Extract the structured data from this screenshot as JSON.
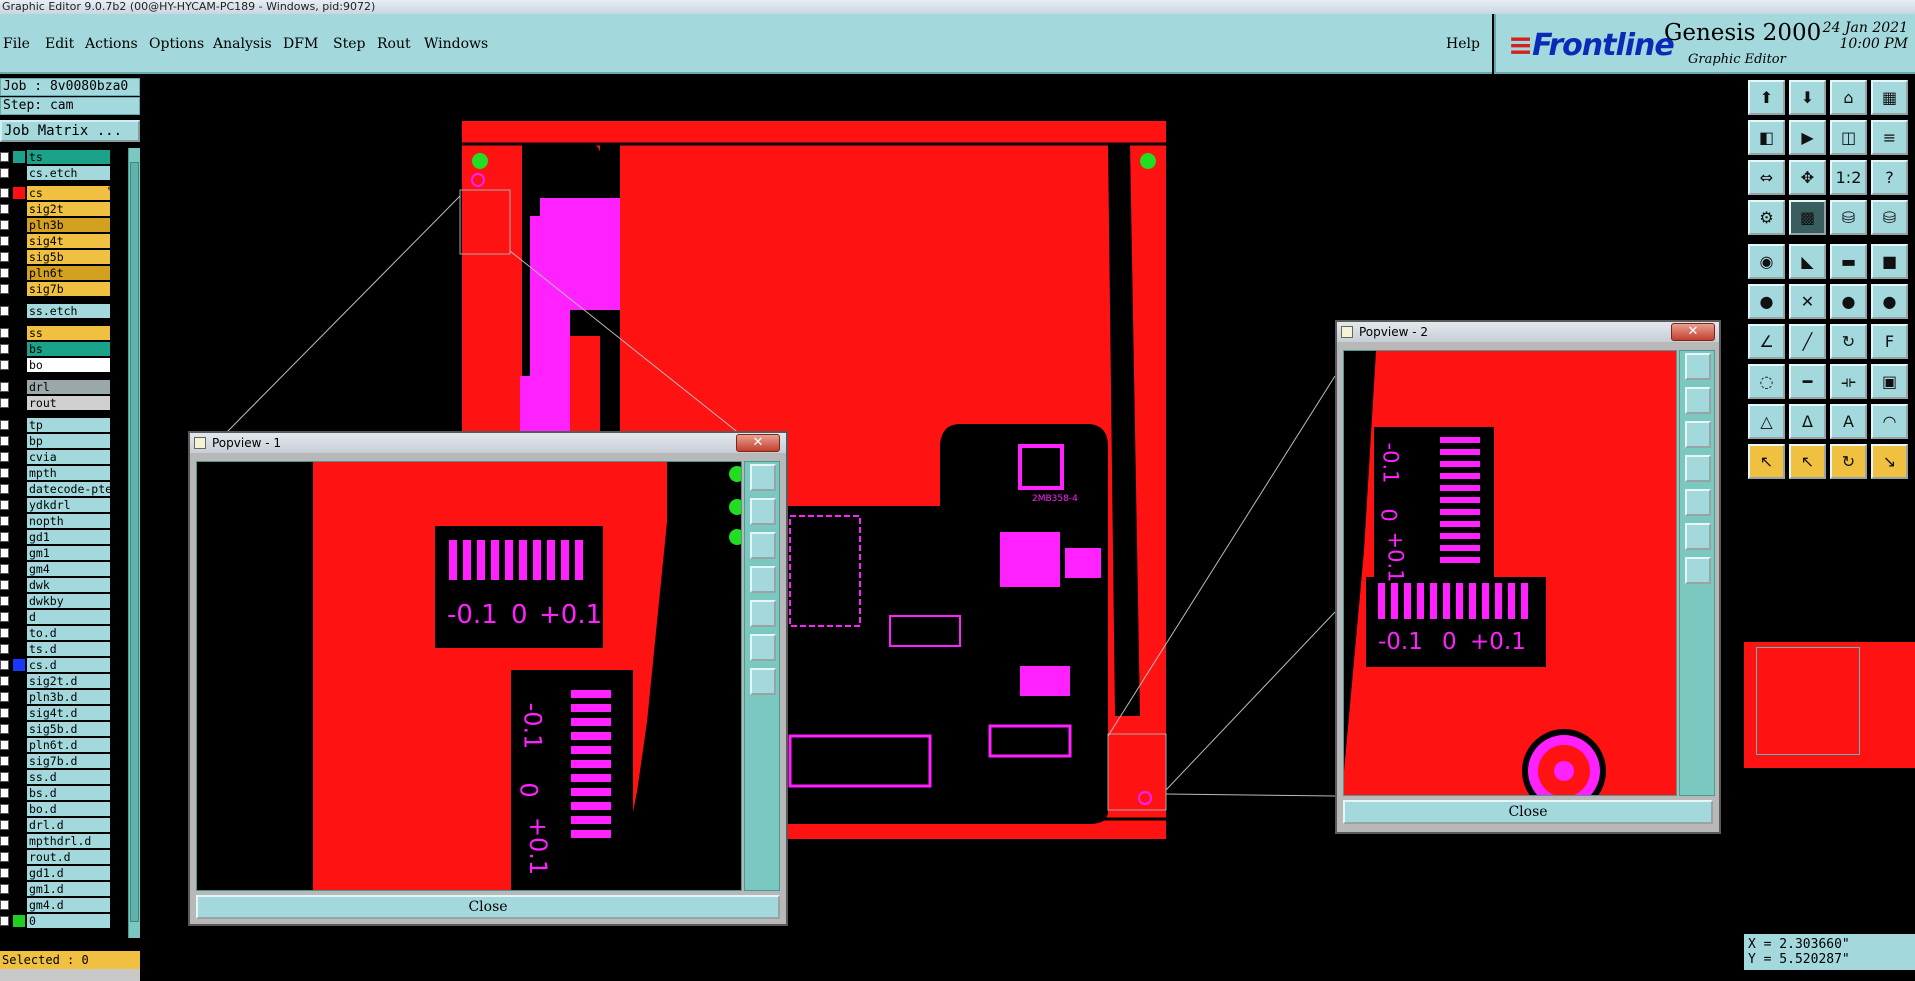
{
  "window_title": "Graphic Editor 9.0.7b2 (00@HY-HYCAM-PC189 - Windows, pid:9072)",
  "menu": [
    "File",
    "Edit",
    "Actions",
    "Options",
    "Analysis",
    "DFM",
    "Step",
    "Rout",
    "Windows"
  ],
  "help_label": "Help",
  "brand": {
    "logo": "Frontline",
    "product": "Genesis 2000",
    "subtitle": "Graphic Editor",
    "date": "24 Jan 2021",
    "time": "10:00 PM"
  },
  "job_label": "Job : 8v0080bza0",
  "step_label": "Step: cam",
  "job_matrix_button": "Job Matrix ...",
  "layers": [
    {
      "name": "ts",
      "color": "#1aa38a",
      "bg": "#1aa38a"
    },
    {
      "name": "cs.etch",
      "color": "#000000",
      "bg": "#a3d8dc"
    },
    {
      "name": "cs",
      "color": "#ff1010",
      "bg": "#f0c040",
      "flag": "✎ ■"
    },
    {
      "name": "sig2t",
      "color": "#000000",
      "bg": "#f0c040"
    },
    {
      "name": "pln3b",
      "color": "#000000",
      "bg": "#d4a020"
    },
    {
      "name": "sig4t",
      "color": "#000000",
      "bg": "#f0c040"
    },
    {
      "name": "sig5b",
      "color": "#000000",
      "bg": "#f0c040"
    },
    {
      "name": "pln6t",
      "color": "#000000",
      "bg": "#d4a020"
    },
    {
      "name": "sig7b",
      "color": "#000000",
      "bg": "#f0c040",
      "flag": "✎"
    },
    {
      "name": "ss.etch",
      "color": "#000000",
      "bg": "#a3d8dc"
    },
    {
      "name": "ss",
      "color": "#000000",
      "bg": "#f0c040",
      "flag": "✎"
    },
    {
      "name": "bs",
      "color": "#000000",
      "bg": "#1aa38a"
    },
    {
      "name": "bo",
      "color": "#000000",
      "bg": "#ffffff"
    },
    {
      "name": "drl",
      "color": "#000000",
      "bg": "#9aa8aa"
    },
    {
      "name": "rout",
      "color": "#000000",
      "bg": "#d0d0d0"
    },
    {
      "name": "tp",
      "color": "#000000",
      "bg": "#a3d8dc"
    },
    {
      "name": "bp",
      "color": "#000000",
      "bg": "#a3d8dc"
    },
    {
      "name": "cvia",
      "color": "#000000",
      "bg": "#a3d8dc"
    },
    {
      "name": "mpth",
      "color": "#000000",
      "bg": "#a3d8dc"
    },
    {
      "name": "datecode-pte",
      "color": "#000000",
      "bg": "#a3d8dc"
    },
    {
      "name": "ydkdrl",
      "color": "#000000",
      "bg": "#a3d8dc"
    },
    {
      "name": "nopth",
      "color": "#000000",
      "bg": "#a3d8dc"
    },
    {
      "name": "gd1",
      "color": "#000000",
      "bg": "#a3d8dc",
      "flag": "✎"
    },
    {
      "name": "gm1",
      "color": "#000000",
      "bg": "#a3d8dc"
    },
    {
      "name": "gm4",
      "color": "#000000",
      "bg": "#a3d8dc"
    },
    {
      "name": "dwk",
      "color": "#000000",
      "bg": "#a3d8dc"
    },
    {
      "name": "dwkby",
      "color": "#000000",
      "bg": "#a3d8dc"
    },
    {
      "name": "d",
      "color": "#000000",
      "bg": "#a3d8dc"
    },
    {
      "name": "to.d",
      "color": "#000000",
      "bg": "#a3d8dc",
      "flag": "✎"
    },
    {
      "name": "ts.d",
      "color": "#000000",
      "bg": "#a3d8dc"
    },
    {
      "name": "cs.d",
      "color": "#1838ff",
      "bg": "#a3d8dc",
      "flag": "✎"
    },
    {
      "name": "sig2t.d",
      "color": "#000000",
      "bg": "#a3d8dc"
    },
    {
      "name": "pln3b.d",
      "color": "#000000",
      "bg": "#a3d8dc"
    },
    {
      "name": "sig4t.d",
      "color": "#000000",
      "bg": "#a3d8dc"
    },
    {
      "name": "sig5b.d",
      "color": "#000000",
      "bg": "#a3d8dc"
    },
    {
      "name": "pln6t.d",
      "color": "#000000",
      "bg": "#a3d8dc"
    },
    {
      "name": "sig7b.d",
      "color": "#000000",
      "bg": "#a3d8dc",
      "flag": "✎"
    },
    {
      "name": "ss.d",
      "color": "#000000",
      "bg": "#a3d8dc",
      "flag": "✎"
    },
    {
      "name": "bs.d",
      "color": "#000000",
      "bg": "#a3d8dc"
    },
    {
      "name": "bo.d",
      "color": "#000000",
      "bg": "#a3d8dc"
    },
    {
      "name": "drl.d",
      "color": "#000000",
      "bg": "#a3d8dc"
    },
    {
      "name": "mpthdrl.d",
      "color": "#000000",
      "bg": "#a3d8dc"
    },
    {
      "name": "rout.d",
      "color": "#000000",
      "bg": "#a3d8dc"
    },
    {
      "name": "gd1.d",
      "color": "#000000",
      "bg": "#a3d8dc",
      "flag": "✎"
    },
    {
      "name": "gm1.d",
      "color": "#000000",
      "bg": "#a3d8dc"
    },
    {
      "name": "gm4.d",
      "color": "#000000",
      "bg": "#a3d8dc"
    },
    {
      "name": "0",
      "color": "#20d020",
      "bg": "#a3d8dc"
    }
  ],
  "selected_label": "Selected : 0",
  "popview1": {
    "title": "Popview - 1",
    "close_label": "Close",
    "scale_h": {
      "minus": "-0.1",
      "zero": "0",
      "plus": "+0.1"
    },
    "scale_v": {
      "minus": "-0.1",
      "zero": "0",
      "plus": "+0.1"
    }
  },
  "popview2": {
    "title": "Popview - 2",
    "close_label": "Close",
    "scale_h": {
      "minus": "-0.1",
      "zero": "0",
      "plus": "+0.1"
    },
    "scale_v": {
      "minus": "-0.1",
      "zero": "0",
      "plus": "+0.1"
    }
  },
  "component_label": "2MB358-4",
  "coords": {
    "x": "X = 2.303660\"",
    "y": "Y = 5.520287\""
  },
  "colors": {
    "copper": "#ff1212",
    "silkscreen": "#ff22ff",
    "panel": "#a3d8dc",
    "selected_layer": "#f0c040"
  }
}
